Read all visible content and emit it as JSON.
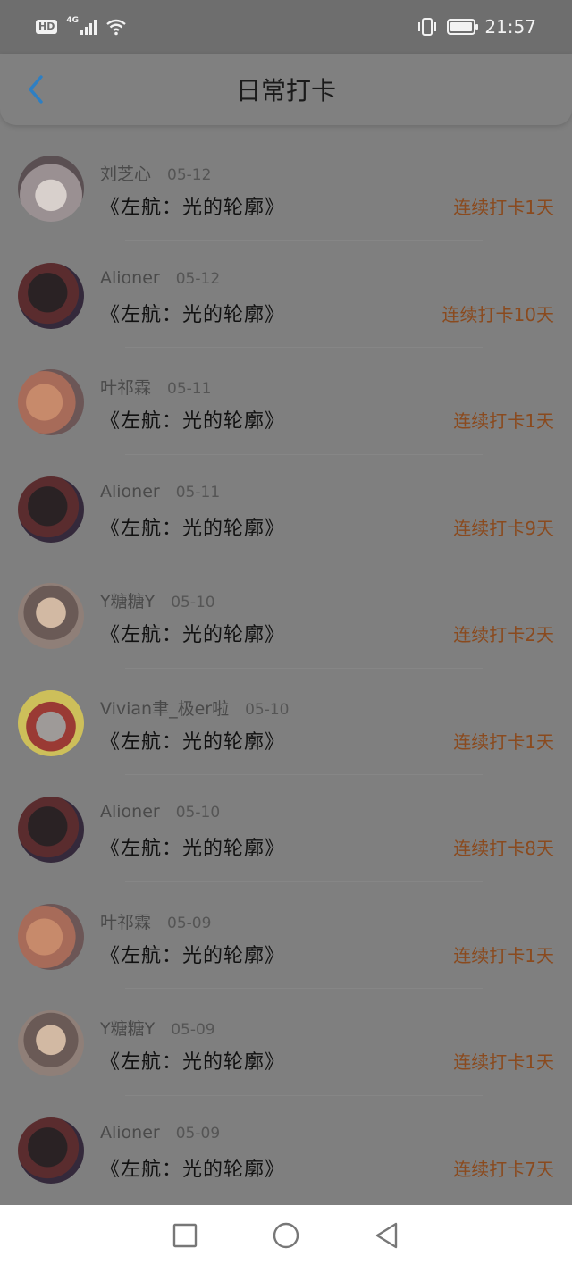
{
  "status_bar": {
    "hd_label": "HD",
    "network_type": "4G",
    "time": "21:57"
  },
  "header": {
    "title": "日常打卡",
    "back_icon": "chevron-left-icon",
    "accent_color": "#2e7fc3"
  },
  "streak_color": "#8a4a1e",
  "records": [
    {
      "username": "刘芝心",
      "date": "05-12",
      "book": "《左航：光的轮廓》",
      "streak": "连续打卡1天",
      "avatar": "boy"
    },
    {
      "username": "Alioner",
      "date": "05-12",
      "book": "《左航：光的轮廓》",
      "streak": "连续打卡10天",
      "avatar": "girl-dark"
    },
    {
      "username": "叶祁霖",
      "date": "05-11",
      "book": "《左航：光的轮廓》",
      "streak": "连续打卡1天",
      "avatar": "girl-warm"
    },
    {
      "username": "Alioner",
      "date": "05-11",
      "book": "《左航：光的轮廓》",
      "streak": "连续打卡9天",
      "avatar": "girl-dark"
    },
    {
      "username": "Y糖糖Y",
      "date": "05-10",
      "book": "《左航：光的轮廓》",
      "streak": "连续打卡2天",
      "avatar": "girl-hat"
    },
    {
      "username": "Vivian聿_极er啦",
      "date": "05-10",
      "book": "《左航：光的轮廓》",
      "streak": "连续打卡1天",
      "avatar": "cartoon"
    },
    {
      "username": "Alioner",
      "date": "05-10",
      "book": "《左航：光的轮廓》",
      "streak": "连续打卡8天",
      "avatar": "girl-dark"
    },
    {
      "username": "叶祁霖",
      "date": "05-09",
      "book": "《左航：光的轮廓》",
      "streak": "连续打卡1天",
      "avatar": "girl-warm"
    },
    {
      "username": "Y糖糖Y",
      "date": "05-09",
      "book": "《左航：光的轮廓》",
      "streak": "连续打卡1天",
      "avatar": "girl-hat"
    },
    {
      "username": "Alioner",
      "date": "05-09",
      "book": "《左航：光的轮廓》",
      "streak": "连续打卡7天",
      "avatar": "girl-dark"
    }
  ],
  "nav_bar": {
    "recent_icon": "square-icon",
    "home_icon": "circle-icon",
    "back_icon": "triangle-back-icon"
  }
}
